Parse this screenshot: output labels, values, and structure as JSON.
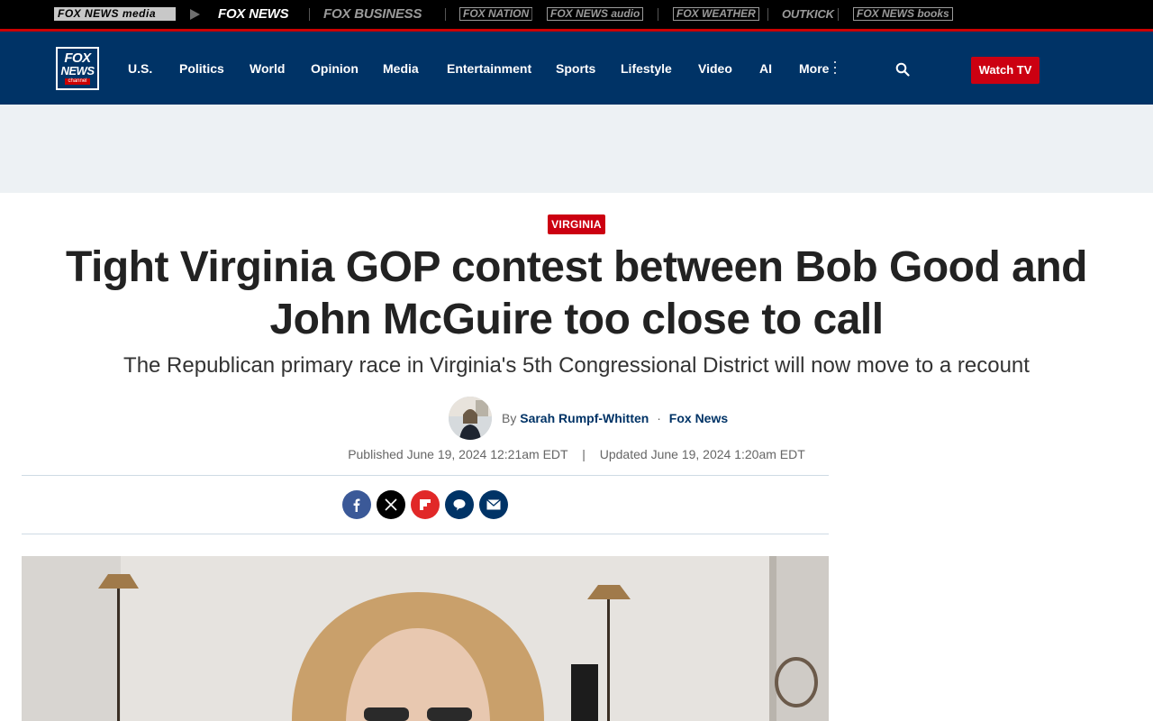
{
  "network": {
    "items": [
      {
        "label": "FOX NEWS media"
      },
      {
        "label": "FOX NEWS"
      },
      {
        "label": "FOX BUSINESS"
      },
      {
        "label": "FOX NATION"
      },
      {
        "label": "FOX NEWS audio"
      },
      {
        "label": "FOX WEATHER"
      },
      {
        "label": "OUTKICK"
      },
      {
        "label": "FOX NEWS books"
      }
    ]
  },
  "logo": {
    "line1": "FOX",
    "line2": "NEWS",
    "line3": "channel"
  },
  "nav": {
    "links": [
      {
        "label": "U.S."
      },
      {
        "label": "Politics"
      },
      {
        "label": "World"
      },
      {
        "label": "Opinion"
      },
      {
        "label": "Media"
      },
      {
        "label": "Entertainment"
      },
      {
        "label": "Sports"
      },
      {
        "label": "Lifestyle"
      },
      {
        "label": "Video"
      },
      {
        "label": "AI"
      },
      {
        "label": "More"
      }
    ],
    "watch_label": "Watch TV"
  },
  "article": {
    "kicker": "VIRGINIA",
    "headline": "Tight Virginia GOP contest between Bob Good and John McGuire too close to call",
    "subhead": "The Republican primary race in Virginia's 5th Congressional District will now move to a recount",
    "by": "By",
    "author": "Sarah Rumpf-Whitten",
    "separator": "·",
    "outlet": "Fox News",
    "published": "Published June 19, 2024 12:21am EDT",
    "pipe": "|",
    "updated": "Updated June 19, 2024 1:20am EDT"
  },
  "share": [
    {
      "icon": "facebook-icon",
      "color": "#3b5998"
    },
    {
      "icon": "x-icon",
      "color": "#000000"
    },
    {
      "icon": "flipboard-icon",
      "color": "#e12828"
    },
    {
      "icon": "comments-icon",
      "color": "#003366"
    },
    {
      "icon": "email-icon",
      "color": "#003366"
    }
  ],
  "colors": {
    "brand_navy": "#003366",
    "brand_red": "#cc0011",
    "ad_bg": "#edf1f4"
  }
}
